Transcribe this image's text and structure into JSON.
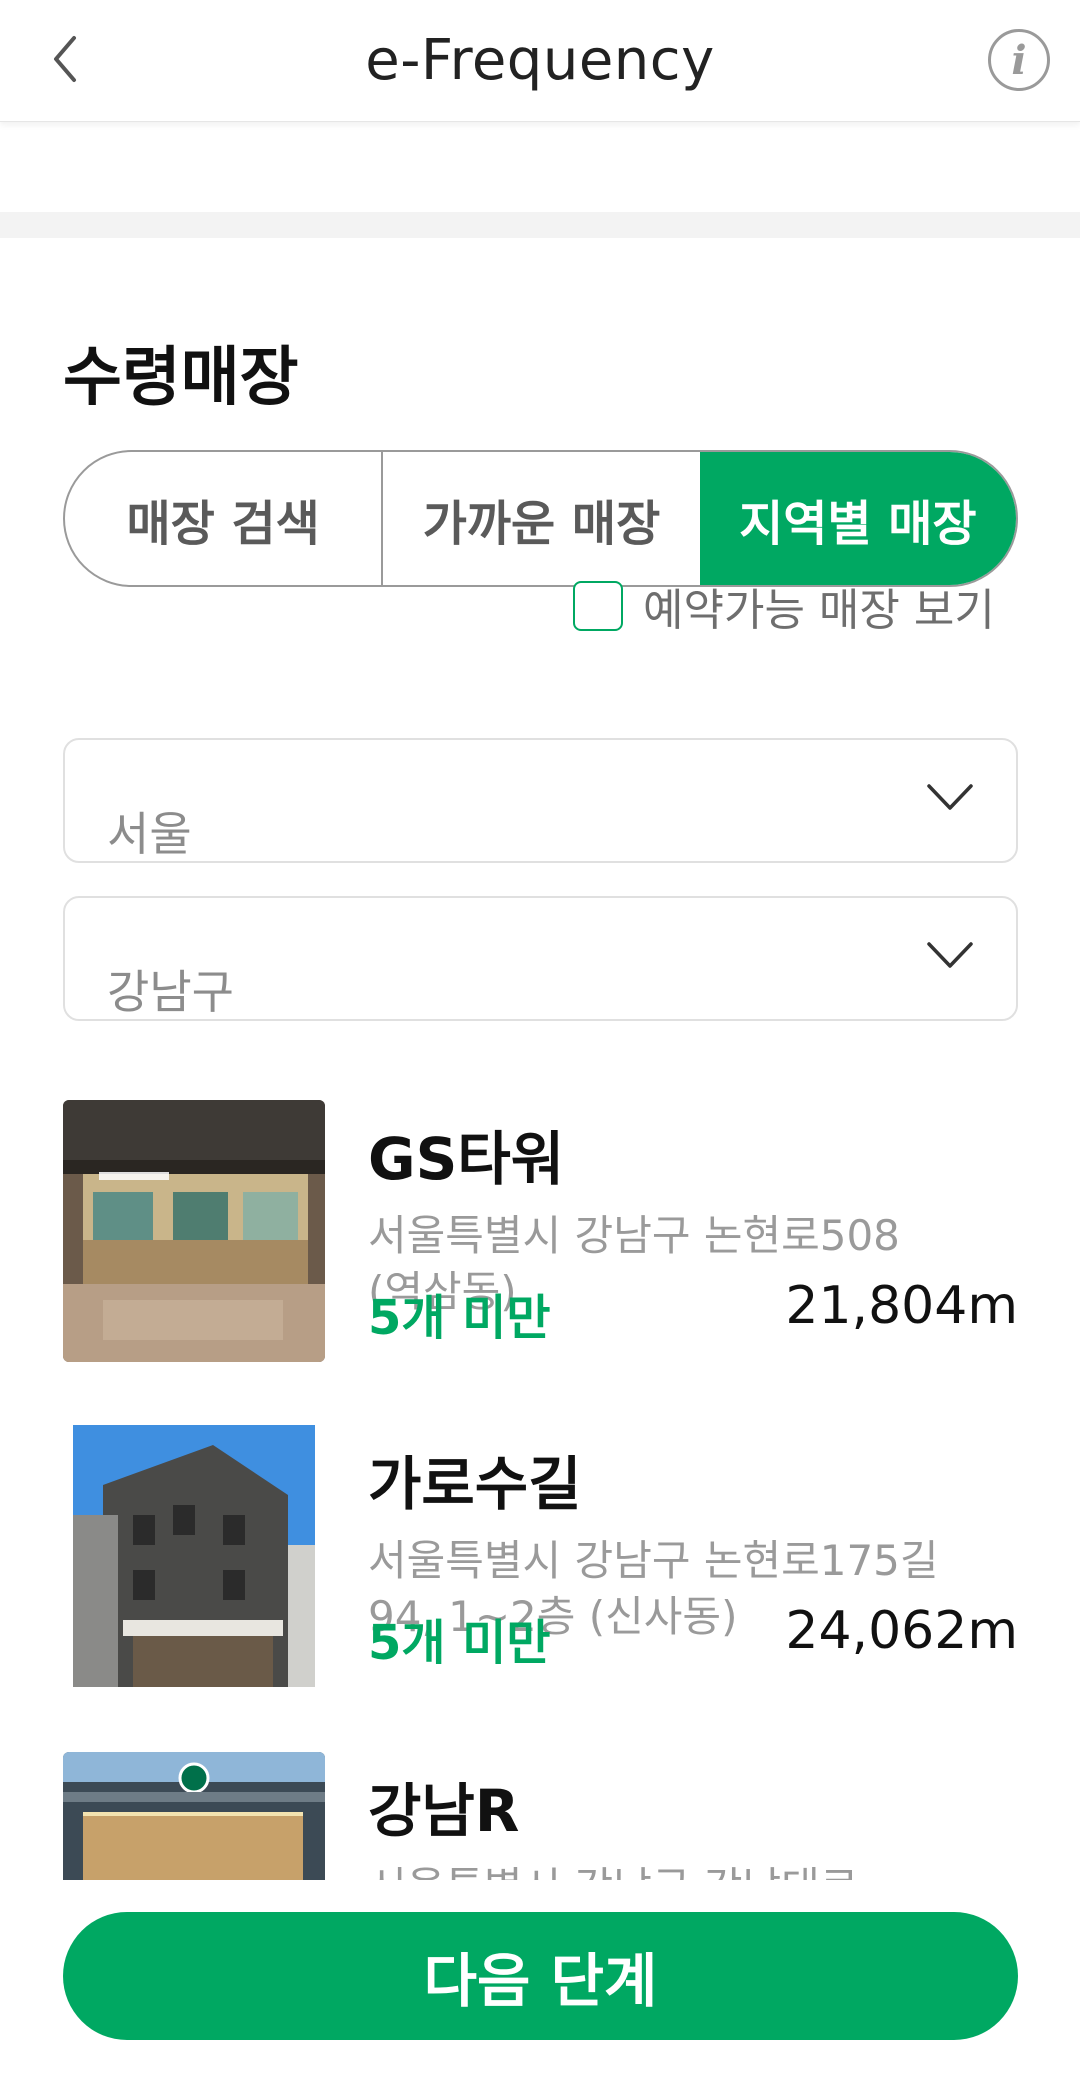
{
  "header": {
    "title": "e-Frequency",
    "info_glyph": "i"
  },
  "pickup": {
    "section_title": "수령매장",
    "tabs": [
      {
        "label": "매장 검색",
        "active": false
      },
      {
        "label": "가까운 매장",
        "active": false
      },
      {
        "label": "지역별 매장",
        "active": true
      }
    ],
    "reservable_only": {
      "label": "예약가능 매장 보기",
      "checked": false
    },
    "city_select": {
      "value": "서울"
    },
    "district_select": {
      "value": "강남구"
    }
  },
  "stores": [
    {
      "name": "GS타워",
      "address": "서울특별시 강남구 논현로508 (역삼동)",
      "stock": "5개 미만",
      "distance": "21,804m"
    },
    {
      "name": "가로수길",
      "address": "서울특별시 강남구 논현로175길94, 1~2층 (신사동)",
      "stock": "5개 미만",
      "distance": "24,062m"
    },
    {
      "name": "강남R",
      "address": "서울특별시 강남구 강남대로",
      "stock": "",
      "distance": ""
    }
  ],
  "footer": {
    "next_label": "다음 단계"
  },
  "colors": {
    "accent": "#00a862",
    "muted_text": "#9a9a9a"
  }
}
